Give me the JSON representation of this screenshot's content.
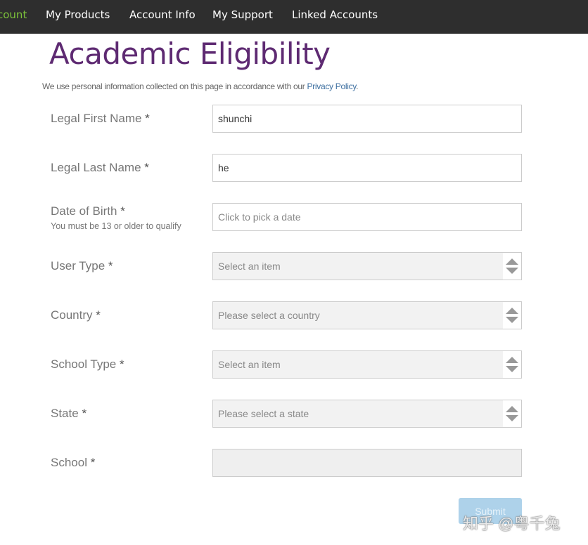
{
  "nav": {
    "items": [
      {
        "label": "count",
        "active": true
      },
      {
        "label": "My Products"
      },
      {
        "label": "Account Info"
      },
      {
        "label": "My Support"
      },
      {
        "label": "Linked Accounts"
      }
    ]
  },
  "page": {
    "title": "Academic Eligibility",
    "notice_prefix": "We use personal information collected on this page in accordance with our ",
    "privacy_link": "Privacy Policy",
    "notice_suffix": "."
  },
  "form": {
    "required_mark": "*",
    "first_name": {
      "label": "Legal First Name",
      "value": "shunchi"
    },
    "last_name": {
      "label": "Legal Last Name",
      "value": "he"
    },
    "dob": {
      "label": "Date of Birth",
      "hint": "You must be 13 or older to qualify",
      "placeholder": "Click to pick a date"
    },
    "user_type": {
      "label": "User Type",
      "placeholder": "Select an item"
    },
    "country": {
      "label": "Country",
      "placeholder": "Please select a country"
    },
    "school_type": {
      "label": "School Type",
      "placeholder": "Select an item"
    },
    "state": {
      "label": "State",
      "placeholder": "Please select a state"
    },
    "school": {
      "label": "School",
      "value": ""
    },
    "submit_label": "Submit"
  },
  "watermark": "知乎 @粤千兔",
  "colors": {
    "nav_bg": "#2e2e2e",
    "active_nav": "#7cc23a",
    "title": "#5e2a72",
    "submit": "#aed2ea"
  }
}
